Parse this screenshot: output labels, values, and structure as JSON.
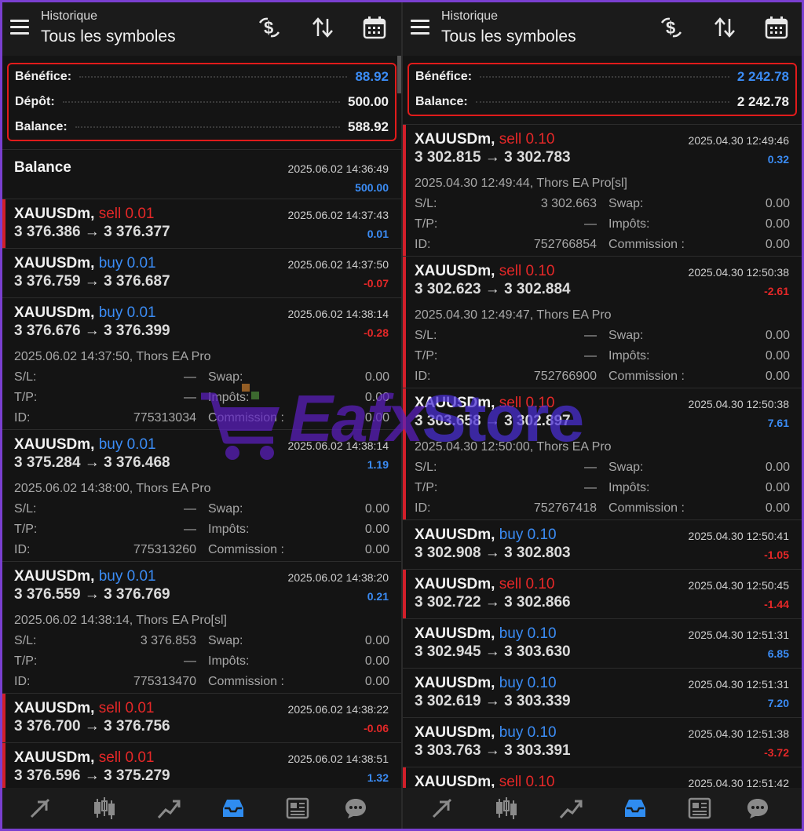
{
  "left": {
    "header": {
      "subtitle": "Historique",
      "title": "Tous les symboles"
    },
    "summary": [
      {
        "label": "Bénéfice:",
        "value": "88.92",
        "accent": true
      },
      {
        "label": "Dépôt:",
        "value": "500.00",
        "accent": false
      },
      {
        "label": "Balance:",
        "value": "588.92",
        "accent": false
      }
    ],
    "balance_entry": {
      "title": "Balance",
      "date": "2025.06.02 14:36:49",
      "amount": "500.00"
    },
    "trades": [
      {
        "symbol": "XAUUSDm,",
        "side": "sell 0.01",
        "side_type": "sell",
        "prices": "3 376.386 → 3 376.377",
        "date": "2025.06.02 14:37:43",
        "profit": "0.01",
        "positive": true,
        "expanded": false
      },
      {
        "symbol": "XAUUSDm,",
        "side": "buy 0.01",
        "side_type": "buy",
        "prices": "3 376.759 → 3 376.687",
        "date": "2025.06.02 14:37:50",
        "profit": "-0.07",
        "positive": false,
        "expanded": false
      },
      {
        "symbol": "XAUUSDm,",
        "side": "buy 0.01",
        "side_type": "buy",
        "prices": "3 376.676 → 3 376.399",
        "date": "2025.06.02 14:38:14",
        "profit": "-0.28",
        "positive": false,
        "expanded": true,
        "detail": "2025.06.02 14:37:50, Thors EA Pro",
        "sl": "—",
        "tp": "—",
        "id": "775313034",
        "swap": "0.00",
        "taxes": "0.00",
        "commission": "0.00"
      },
      {
        "symbol": "XAUUSDm,",
        "side": "buy 0.01",
        "side_type": "buy",
        "prices": "3 375.284 → 3 376.468",
        "date": "2025.06.02 14:38:14",
        "profit": "1.19",
        "positive": true,
        "expanded": true,
        "detail": "2025.06.02 14:38:00, Thors EA Pro",
        "sl": "—",
        "tp": "—",
        "id": "775313260",
        "swap": "0.00",
        "taxes": "0.00",
        "commission": "0.00"
      },
      {
        "symbol": "XAUUSDm,",
        "side": "buy 0.01",
        "side_type": "buy",
        "prices": "3 376.559 → 3 376.769",
        "date": "2025.06.02 14:38:20",
        "profit": "0.21",
        "positive": true,
        "expanded": true,
        "detail": "2025.06.02 14:38:14, Thors EA Pro[sl]",
        "sl": "3 376.853",
        "tp": "—",
        "id": "775313470",
        "swap": "0.00",
        "taxes": "0.00",
        "commission": "0.00"
      },
      {
        "symbol": "XAUUSDm,",
        "side": "sell 0.01",
        "side_type": "sell",
        "prices": "3 376.700 → 3 376.756",
        "date": "2025.06.02 14:38:22",
        "profit": "-0.06",
        "positive": false,
        "expanded": false
      },
      {
        "symbol": "XAUUSDm,",
        "side": "sell 0.01",
        "side_type": "sell",
        "prices": "3 376.596 → 3 375.279",
        "date": "2025.06.02 14:38:51",
        "profit": "1.32",
        "positive": true,
        "expanded": false
      }
    ]
  },
  "right": {
    "header": {
      "subtitle": "Historique",
      "title": "Tous les symboles"
    },
    "summary": [
      {
        "label": "Bénéfice:",
        "value": "2 242.78",
        "accent": true
      },
      {
        "label": "Balance:",
        "value": "2 242.78",
        "accent": false
      }
    ],
    "trades": [
      {
        "symbol": "XAUUSDm,",
        "side": "sell 0.10",
        "side_type": "sell",
        "prices": "3 302.815 → 3 302.783",
        "date": "2025.04.30 12:49:46",
        "profit": "0.32",
        "positive": true,
        "expanded": true,
        "detail": "2025.04.30 12:49:44, Thors EA Pro[sl]",
        "sl": "3 302.663",
        "tp": "—",
        "id": "752766854",
        "swap": "0.00",
        "taxes": "0.00",
        "commission": "0.00"
      },
      {
        "symbol": "XAUUSDm,",
        "side": "sell 0.10",
        "side_type": "sell",
        "prices": "3 302.623 → 3 302.884",
        "date": "2025.04.30 12:50:38",
        "profit": "-2.61",
        "positive": false,
        "expanded": true,
        "detail": "2025.04.30 12:49:47, Thors EA Pro",
        "sl": "—",
        "tp": "—",
        "id": "752766900",
        "swap": "0.00",
        "taxes": "0.00",
        "commission": "0.00"
      },
      {
        "symbol": "XAUUSDm,",
        "side": "sell 0.10",
        "side_type": "sell",
        "prices": "3 303.658 → 3 302.897",
        "date": "2025.04.30 12:50:38",
        "profit": "7.61",
        "positive": true,
        "expanded": true,
        "detail": "2025.04.30 12:50:00, Thors EA Pro",
        "sl": "—",
        "tp": "—",
        "id": "752767418",
        "swap": "0.00",
        "taxes": "0.00",
        "commission": "0.00"
      },
      {
        "symbol": "XAUUSDm,",
        "side": "buy 0.10",
        "side_type": "buy",
        "prices": "3 302.908 → 3 302.803",
        "date": "2025.04.30 12:50:41",
        "profit": "-1.05",
        "positive": false,
        "expanded": false
      },
      {
        "symbol": "XAUUSDm,",
        "side": "sell 0.10",
        "side_type": "sell",
        "prices": "3 302.722 → 3 302.866",
        "date": "2025.04.30 12:50:45",
        "profit": "-1.44",
        "positive": false,
        "expanded": false
      },
      {
        "symbol": "XAUUSDm,",
        "side": "buy 0.10",
        "side_type": "buy",
        "prices": "3 302.945 → 3 303.630",
        "date": "2025.04.30 12:51:31",
        "profit": "6.85",
        "positive": true,
        "expanded": false
      },
      {
        "symbol": "XAUUSDm,",
        "side": "buy 0.10",
        "side_type": "buy",
        "prices": "3 302.619 → 3 303.339",
        "date": "2025.04.30 12:51:31",
        "profit": "7.20",
        "positive": true,
        "expanded": false
      },
      {
        "symbol": "XAUUSDm,",
        "side": "buy 0.10",
        "side_type": "buy",
        "prices": "3 303.763 → 3 303.391",
        "date": "2025.04.30 12:51:38",
        "profit": "-3.72",
        "positive": false,
        "expanded": false
      },
      {
        "symbol": "XAUUSDm,",
        "side": "sell 0.10",
        "side_type": "sell",
        "prices": "",
        "date": "2025.04.30 12:51:42",
        "profit": "",
        "positive": true,
        "expanded": false
      }
    ]
  },
  "labels": {
    "sl": "S/L:",
    "tp": "T/P:",
    "id": "ID:",
    "swap": "Swap:",
    "taxes": "Impôts:",
    "commission": "Commission :"
  },
  "watermark": {
    "brand": "Eafx",
    "brand2": "Store"
  },
  "icons": {
    "header": [
      "menu-icon",
      "currency-exchange-icon",
      "sort-icon",
      "calendar-icon"
    ],
    "nav": [
      "trade-icon",
      "chart-candles-icon",
      "chart-line-icon",
      "history-inbox-icon",
      "news-icon",
      "chat-icon"
    ]
  },
  "colors": {
    "buy": "#3b8cf5",
    "sell": "#e52828",
    "highlight_border": "#e11b1b",
    "active_tab": "#2f8cf0"
  }
}
